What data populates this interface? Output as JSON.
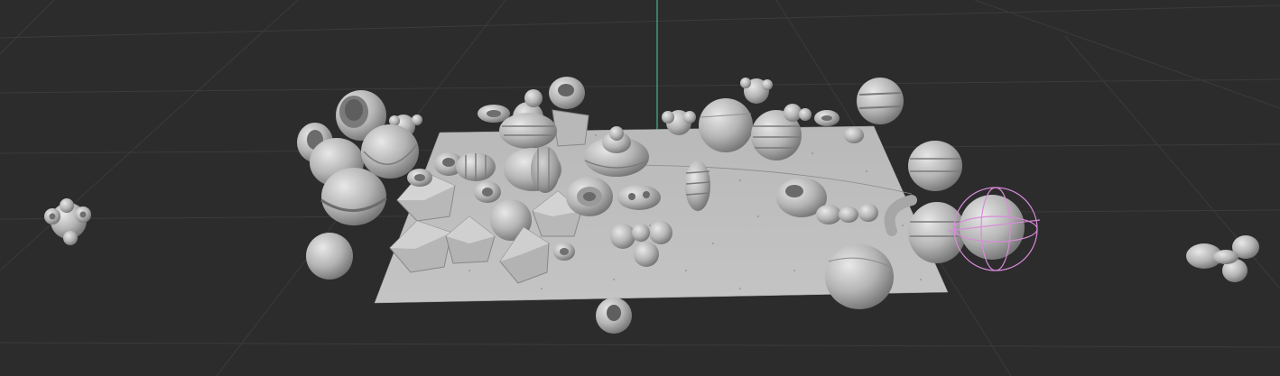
{
  "viewport": {
    "name": "3d-viewport",
    "background": "#2c2c2c",
    "grid_color": "#3d3d3d",
    "floor_color": "#bdbdbd",
    "object_color": "#a9a9a9",
    "z_axis_color": "#3fb58e",
    "gizmo_color": "#d98bd9"
  },
  "scene": {
    "object_count": 52,
    "selected_object": "sphere-with-rotate-gizmo"
  }
}
